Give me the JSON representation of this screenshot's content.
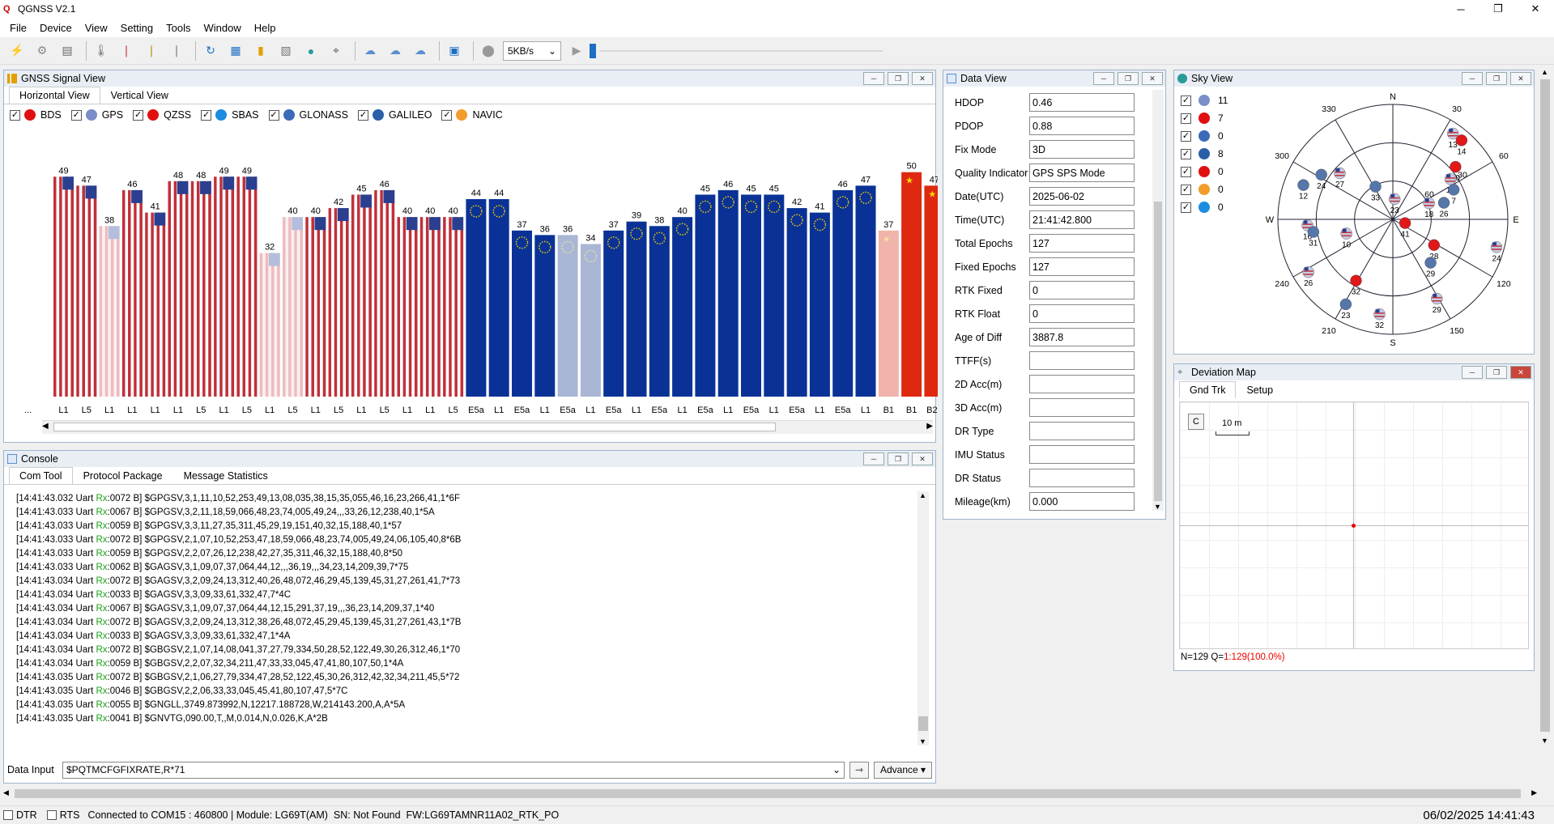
{
  "window": {
    "title": "QGNSS V2.1",
    "min": "─",
    "max": "❐",
    "close": "✕"
  },
  "menu": [
    "File",
    "Device",
    "View",
    "Setting",
    "Tools",
    "Window",
    "Help"
  ],
  "toolbar": {
    "speed": "5KB/s",
    "stop_icon": "stop-icon",
    "play_icon": "play-icon"
  },
  "signal_view": {
    "title": "GNSS Signal View",
    "tabs": [
      "Horizontal View",
      "Vertical View"
    ],
    "constellations": [
      {
        "name": "BDS",
        "color": "#e01010"
      },
      {
        "name": "GPS",
        "color": "#7a8ec8"
      },
      {
        "name": "QZSS",
        "color": "#e01010"
      },
      {
        "name": "SBAS",
        "color": "#1a8de0"
      },
      {
        "name": "GLONASS",
        "color": "#3b6bb8"
      },
      {
        "name": "GALILEO",
        "color": "#2a5fa8"
      },
      {
        "name": "NAVIC",
        "color": "#f29c2b"
      }
    ],
    "ellipsis": "..."
  },
  "chart_data": {
    "type": "bar",
    "ylim": [
      0,
      55
    ],
    "bars": [
      {
        "value": 49,
        "label": "L1",
        "sys": "GPS",
        "weak": false
      },
      {
        "value": 47,
        "label": "L5",
        "sys": "GPS",
        "weak": false
      },
      {
        "value": 38,
        "label": "L1",
        "sys": "GPS",
        "weak": true
      },
      {
        "value": 46,
        "label": "L1",
        "sys": "GPS",
        "weak": false
      },
      {
        "value": 41,
        "label": "L1",
        "sys": "GPS",
        "weak": false
      },
      {
        "value": 48,
        "label": "L1",
        "sys": "GPS",
        "weak": false
      },
      {
        "value": 48,
        "label": "L5",
        "sys": "GPS",
        "weak": false
      },
      {
        "value": 49,
        "label": "L1",
        "sys": "GPS",
        "weak": false
      },
      {
        "value": 49,
        "label": "L5",
        "sys": "GPS",
        "weak": false
      },
      {
        "value": 32,
        "label": "L1",
        "sys": "GPS",
        "weak": true
      },
      {
        "value": 40,
        "label": "L5",
        "sys": "GPS",
        "weak": true
      },
      {
        "value": 40,
        "label": "L1",
        "sys": "GPS",
        "weak": false
      },
      {
        "value": 42,
        "label": "L5",
        "sys": "GPS",
        "weak": false
      },
      {
        "value": 45,
        "label": "L1",
        "sys": "GPS",
        "weak": false
      },
      {
        "value": 46,
        "label": "L5",
        "sys": "GPS",
        "weak": false
      },
      {
        "value": 40,
        "label": "L1",
        "sys": "GPS",
        "weak": false
      },
      {
        "value": 40,
        "label": "L1",
        "sys": "GPS",
        "weak": false
      },
      {
        "value": 40,
        "label": "L5",
        "sys": "GPS",
        "weak": false
      },
      {
        "value": 44,
        "label": "E5a",
        "sys": "GAL",
        "weak": false
      },
      {
        "value": 44,
        "label": "L1",
        "sys": "GAL",
        "weak": false
      },
      {
        "value": 37,
        "label": "E5a",
        "sys": "GAL",
        "weak": false
      },
      {
        "value": 36,
        "label": "L1",
        "sys": "GAL",
        "weak": false
      },
      {
        "value": 36,
        "label": "E5a",
        "sys": "GAL",
        "weak": true
      },
      {
        "value": 34,
        "label": "L1",
        "sys": "GAL",
        "weak": true
      },
      {
        "value": 37,
        "label": "E5a",
        "sys": "GAL",
        "weak": false
      },
      {
        "value": 39,
        "label": "L1",
        "sys": "GAL",
        "weak": false
      },
      {
        "value": 38,
        "label": "E5a",
        "sys": "GAL",
        "weak": false
      },
      {
        "value": 40,
        "label": "L1",
        "sys": "GAL",
        "weak": false
      },
      {
        "value": 45,
        "label": "E5a",
        "sys": "GAL",
        "weak": false
      },
      {
        "value": 46,
        "label": "L1",
        "sys": "GAL",
        "weak": false
      },
      {
        "value": 45,
        "label": "E5a",
        "sys": "GAL",
        "weak": false
      },
      {
        "value": 45,
        "label": "L1",
        "sys": "GAL",
        "weak": false
      },
      {
        "value": 42,
        "label": "E5a",
        "sys": "GAL",
        "weak": false
      },
      {
        "value": 41,
        "label": "L1",
        "sys": "GAL",
        "weak": false
      },
      {
        "value": 46,
        "label": "E5a",
        "sys": "GAL",
        "weak": false
      },
      {
        "value": 47,
        "label": "L1",
        "sys": "GAL",
        "weak": false
      },
      {
        "value": 37,
        "label": "B1",
        "sys": "BDS",
        "weak": true
      },
      {
        "value": 50,
        "label": "B1",
        "sys": "BDS",
        "weak": false
      },
      {
        "value": 47,
        "label": "B2a",
        "sys": "BDS",
        "weak": false
      }
    ],
    "colors": {
      "GAL": "#0a3296",
      "GAL_weak": "#a9b6d6",
      "BDS": "#de2910",
      "BDS_weak": "#f0b4ac",
      "GPS_red": "#c0303a",
      "GPS_blue": "#2a3f8f"
    }
  },
  "console": {
    "title": "Console",
    "tabs": [
      "Com Tool",
      "Protocol Package",
      "Message Statistics"
    ],
    "lines": [
      {
        "pre": "[14:41:43.032 Uart ",
        "rx": "Rx",
        "post": ":0072 B] $GPGSV,3,1,11,10,52,253,49,13,08,035,38,15,35,055,46,16,23,266,41,1*6F"
      },
      {
        "pre": "[14:41:43.033 Uart ",
        "rx": "Rx",
        "post": ":0067 B] $GPGSV,3,2,11,18,59,066,48,23,74,005,49,24,,,33,26,12,238,40,1*5A"
      },
      {
        "pre": "[14:41:43.033 Uart ",
        "rx": "Rx",
        "post": ":0059 B] $GPGSV,3,3,11,27,35,311,45,29,19,151,40,32,15,188,40,1*57"
      },
      {
        "pre": "[14:41:43.033 Uart ",
        "rx": "Rx",
        "post": ":0072 B] $GPGSV,2,1,07,10,52,253,47,18,59,066,48,23,74,005,49,24,06,105,40,8*6B"
      },
      {
        "pre": "[14:41:43.033 Uart ",
        "rx": "Rx",
        "post": ":0059 B] $GPGSV,2,2,07,26,12,238,42,27,35,311,46,32,15,188,40,8*50"
      },
      {
        "pre": "[14:41:43.033 Uart ",
        "rx": "Rx",
        "post": ":0062 B] $GAGSV,3,1,09,07,37,064,44,12,,,36,19,,,34,23,14,209,39,7*75"
      },
      {
        "pre": "[14:41:43.034 Uart ",
        "rx": "Rx",
        "post": ":0072 B] $GAGSV,3,2,09,24,13,312,40,26,48,072,46,29,45,139,45,31,27,261,41,7*73"
      },
      {
        "pre": "[14:41:43.034 Uart ",
        "rx": "Rx",
        "post": ":0033 B] $GAGSV,3,3,09,33,61,332,47,7*4C"
      },
      {
        "pre": "[14:41:43.034 Uart ",
        "rx": "Rx",
        "post": ":0067 B] $GAGSV,3,1,09,07,37,064,44,12,15,291,37,19,,,36,23,14,209,37,1*40"
      },
      {
        "pre": "[14:41:43.034 Uart ",
        "rx": "Rx",
        "post": ":0072 B] $GAGSV,3,2,09,24,13,312,38,26,48,072,45,29,45,139,45,31,27,261,43,1*7B"
      },
      {
        "pre": "[14:41:43.034 Uart ",
        "rx": "Rx",
        "post": ":0033 B] $GAGSV,3,3,09,33,61,332,47,1*4A"
      },
      {
        "pre": "[14:41:43.034 Uart ",
        "rx": "Rx",
        "post": ":0072 B] $GBGSV,2,1,07,14,08,041,37,27,79,334,50,28,52,122,49,30,26,312,46,1*70"
      },
      {
        "pre": "[14:41:43.034 Uart ",
        "rx": "Rx",
        "post": ":0059 B] $GBGSV,2,2,07,32,34,211,47,33,33,045,47,41,80,107,50,1*4A"
      },
      {
        "pre": "[14:41:43.035 Uart ",
        "rx": "Rx",
        "post": ":0072 B] $GBGSV,2,1,06,27,79,334,47,28,52,122,45,30,26,312,42,32,34,211,45,5*72"
      },
      {
        "pre": "[14:41:43.035 Uart ",
        "rx": "Rx",
        "post": ":0046 B] $GBGSV,2,2,06,33,33,045,45,41,80,107,47,5*7C"
      },
      {
        "pre": "[14:41:43.035 Uart ",
        "rx": "Rx",
        "post": ":0055 B] $GNGLL,3749.873992,N,12217.188728,W,214143.200,A,A*5A"
      },
      {
        "pre": "[14:41:43.035 Uart ",
        "rx": "Rx",
        "post": ":0041 B] $GNVTG,090.00,T,,M,0.014,N,0.026,K,A*2B"
      }
    ],
    "input_label": "Data Input",
    "input_value": "$PQTMCFGFIXRATE,R*71",
    "send_label": "⇾",
    "advance_label": "Advance ▾"
  },
  "data_view": {
    "title": "Data View",
    "rows": [
      {
        "label": "HDOP",
        "value": "0.46"
      },
      {
        "label": "PDOP",
        "value": "0.88"
      },
      {
        "label": "Fix Mode",
        "value": "3D"
      },
      {
        "label": "Quality Indicator",
        "value": "GPS SPS Mode"
      },
      {
        "label": "Date(UTC)",
        "value": "2025-06-02"
      },
      {
        "label": "Time(UTC)",
        "value": "21:41:42.800"
      },
      {
        "label": "Total Epochs",
        "value": "127"
      },
      {
        "label": "Fixed Epochs",
        "value": "127"
      },
      {
        "label": "RTK Fixed",
        "value": "0"
      },
      {
        "label": "RTK Float",
        "value": "0"
      },
      {
        "label": "Age of Diff",
        "value": "3887.8"
      },
      {
        "label": "TTFF(s)",
        "value": ""
      },
      {
        "label": "2D Acc(m)",
        "value": ""
      },
      {
        "label": "3D Acc(m)",
        "value": ""
      },
      {
        "label": "DR Type",
        "value": ""
      },
      {
        "label": "IMU Status",
        "value": ""
      },
      {
        "label": "DR Status",
        "value": ""
      },
      {
        "label": "Mileage(km)",
        "value": "0.000"
      }
    ]
  },
  "sky_view": {
    "title": "Sky View",
    "counts": [
      {
        "sys": "GPS",
        "count": "11",
        "color": "#7a8ec8"
      },
      {
        "sys": "BDS",
        "count": "7",
        "color": "#e01010"
      },
      {
        "sys": "GLONASS",
        "count": "0",
        "color": "#3b6bb8"
      },
      {
        "sys": "GALILEO",
        "count": "8",
        "color": "#2a5fa8"
      },
      {
        "sys": "QZSS",
        "count": "0",
        "color": "#e01010"
      },
      {
        "sys": "NAVIC",
        "count": "0",
        "color": "#f29c2b"
      },
      {
        "sys": "SBAS",
        "count": "0",
        "color": "#1a8de0"
      }
    ],
    "compass": {
      "n": "N",
      "e": "E",
      "s": "S",
      "w": "W"
    },
    "azimuth_labels": [
      "30",
      "60",
      "120",
      "150",
      "210",
      "240",
      "300",
      "330"
    ],
    "elev_labels": [
      "30",
      "60"
    ],
    "satellites": [
      {
        "id": "24",
        "az": 302,
        "el": 24,
        "sys": "GAL"
      },
      {
        "id": "27",
        "az": 311,
        "el": 35,
        "sys": "GPS"
      },
      {
        "id": "12",
        "az": 291,
        "el": 15,
        "sys": "GAL"
      },
      {
        "id": "33",
        "az": 332,
        "el": 61,
        "sys": "GAL"
      },
      {
        "id": "23",
        "az": 5,
        "el": 74,
        "sys": "GPS"
      },
      {
        "id": "13",
        "az": 35,
        "el": 8,
        "sys": "GPS"
      },
      {
        "id": "14",
        "az": 41,
        "el": 8,
        "sys": "BDS"
      },
      {
        "id": "30",
        "az": 50,
        "el": 26,
        "sys": "BDS"
      },
      {
        "id": "15",
        "az": 55,
        "el": 35,
        "sys": "GPS"
      },
      {
        "id": "7",
        "az": 64,
        "el": 37,
        "sys": "GAL"
      },
      {
        "id": "18",
        "az": 66,
        "el": 59,
        "sys": "GPS"
      },
      {
        "id": "26",
        "az": 72,
        "el": 48,
        "sys": "GAL"
      },
      {
        "id": "41",
        "az": 107,
        "el": 80,
        "sys": "BDS"
      },
      {
        "id": "28",
        "az": 122,
        "el": 52,
        "sys": "BDS"
      },
      {
        "id": "24",
        "az": 105,
        "el": 6,
        "sys": "GPS"
      },
      {
        "id": "29",
        "az": 139,
        "el": 45,
        "sys": "GAL"
      },
      {
        "id": "29",
        "az": 151,
        "el": 19,
        "sys": "GPS"
      },
      {
        "id": "32",
        "az": 188,
        "el": 15,
        "sys": "GPS"
      },
      {
        "id": "23",
        "az": 209,
        "el": 14,
        "sys": "GAL"
      },
      {
        "id": "32",
        "az": 211,
        "el": 34,
        "sys": "BDS"
      },
      {
        "id": "26",
        "az": 238,
        "el": 12,
        "sys": "GPS"
      },
      {
        "id": "10",
        "az": 253,
        "el": 52,
        "sys": "GPS"
      },
      {
        "id": "16",
        "az": 266,
        "el": 23,
        "sys": "GPS"
      },
      {
        "id": "31",
        "az": 261,
        "el": 27,
        "sys": "GAL"
      }
    ]
  },
  "deviation_map": {
    "title": "Deviation Map",
    "tabs": [
      "Gnd Trk",
      "Setup"
    ],
    "clear_btn": "C",
    "scale": "10 m",
    "stats_prefix": "N=129 Q=",
    "stats_value": "1:129(100.0%)"
  },
  "status": {
    "dtr": "DTR",
    "rts": "RTS",
    "connection": "Connected to COM15 : 460800 | Module: LG69T(AM)  SN: Not Found  FW:LG69TAMNR11A02_RTK_PO",
    "datetime": "06/02/2025 14:41:43"
  }
}
